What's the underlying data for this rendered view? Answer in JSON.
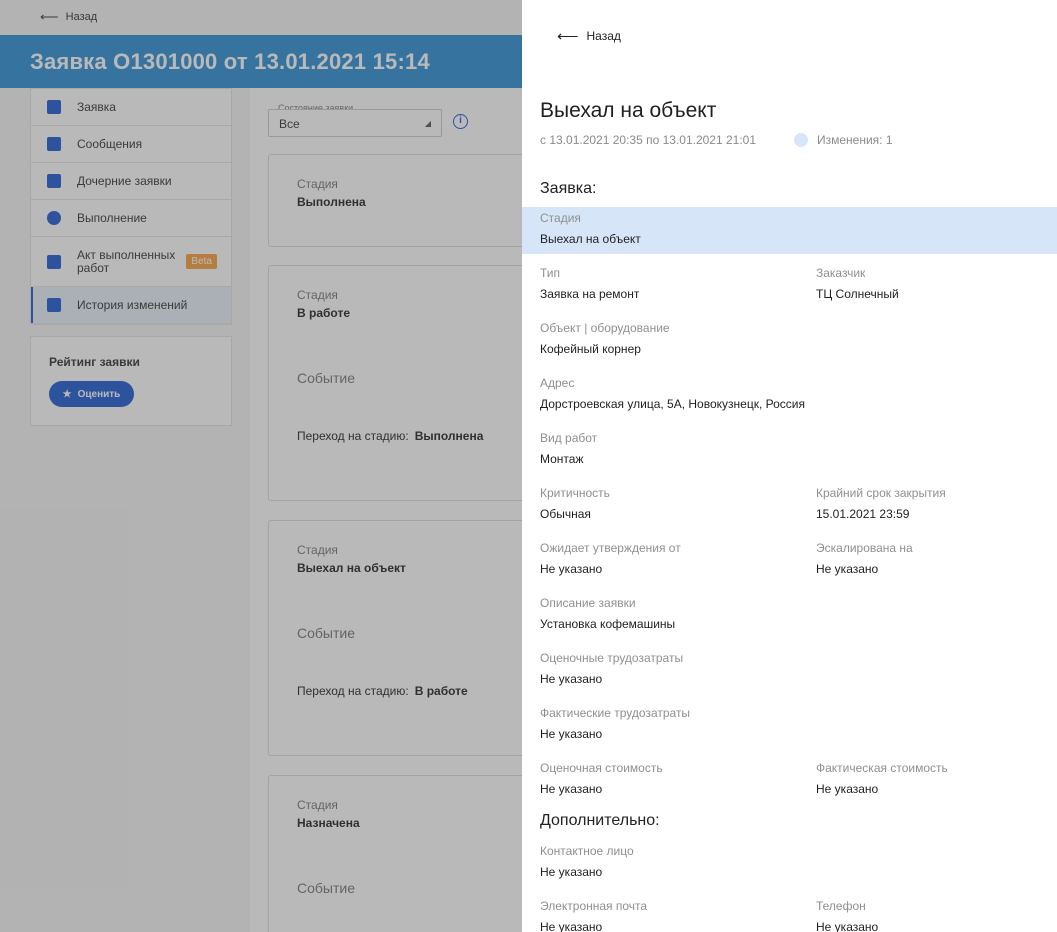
{
  "background": {
    "back_label": "Назад",
    "title": "Заявка О1301000 от 13.01.2021 15:14",
    "sidebar": [
      {
        "label": "Заявка"
      },
      {
        "label": "Сообщения"
      },
      {
        "label": "Дочерние заявки"
      },
      {
        "label": "Выполнение"
      },
      {
        "label": "Акт выполненных работ",
        "badge": "Beta"
      },
      {
        "label": "История изменений"
      }
    ],
    "rating": {
      "title": "Рейтинг заявки",
      "button": "Оценить"
    },
    "state_filter": {
      "label": "Состояние заявки",
      "value": "Все"
    },
    "cards": [
      {
        "stage_label": "Стадия",
        "stage": "Выполнена"
      },
      {
        "stage_label": "Стадия",
        "stage": "В работе",
        "event": "Событие",
        "transition_label": "Переход на стадию:",
        "transition_value": "Выполнена"
      },
      {
        "stage_label": "Стадия",
        "stage": "Выехал на объект",
        "event": "Событие",
        "transition_label": "Переход на стадию:",
        "transition_value": "В работе"
      },
      {
        "stage_label": "Стадия",
        "stage": "Назначена",
        "event": "Событие"
      }
    ]
  },
  "drawer": {
    "back_label": "Назад",
    "title": "Выехал на объект",
    "period": "с 13.01.2021 20:35 по 13.01.2021 21:01",
    "changes": "Изменения: 1",
    "section_request": "Заявка:",
    "section_extra": "Дополнительно:",
    "fields": {
      "stage": {
        "label": "Стадия",
        "value": "Выехал на объект"
      },
      "type": {
        "label": "Тип",
        "value": "Заявка на ремонт"
      },
      "customer": {
        "label": "Заказчик",
        "value": "ТЦ Солнечный"
      },
      "object": {
        "label": "Объект | оборудование",
        "value": "Кофейный корнер"
      },
      "address": {
        "label": "Адрес",
        "value": "Дорстроевская улица, 5А, Новокузнецк, Россия"
      },
      "work_type": {
        "label": "Вид работ",
        "value": "Монтаж"
      },
      "criticality": {
        "label": "Критичность",
        "value": "Обычная"
      },
      "deadline": {
        "label": "Крайний срок закрытия",
        "value": "15.01.2021 23:59"
      },
      "awaiting": {
        "label": "Ожидает утверждения от",
        "value": "Не указано"
      },
      "escalated": {
        "label": "Эскалирована на",
        "value": "Не указано"
      },
      "description": {
        "label": "Описание заявки",
        "value": "Установка кофемашины"
      },
      "est_labor": {
        "label": "Оценочные трудозатраты",
        "value": "Не указано"
      },
      "fact_labor": {
        "label": "Фактические трудозатраты",
        "value": "Не указано"
      },
      "est_cost": {
        "label": "Оценочная стоимость",
        "value": "Не указано"
      },
      "fact_cost": {
        "label": "Фактическая стоимость",
        "value": "Не указано"
      },
      "contact": {
        "label": "Контактное лицо",
        "value": "Не указано"
      },
      "email": {
        "label": "Электронная почта",
        "value": "Не указано"
      },
      "phone": {
        "label": "Телефон",
        "value": "Не указано"
      }
    }
  }
}
